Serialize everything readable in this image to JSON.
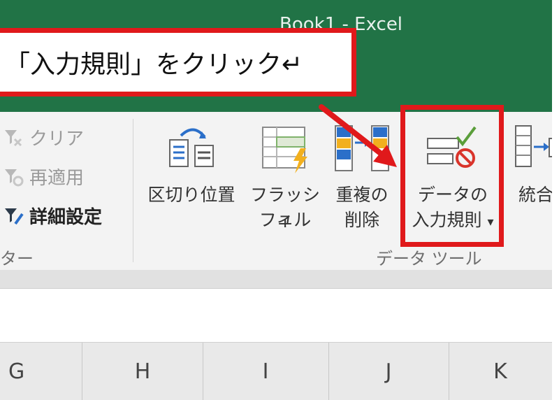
{
  "window": {
    "title": "Book1 - Excel"
  },
  "callout": {
    "text": "「入力規則」をクリック↵"
  },
  "filter_group": {
    "items": [
      {
        "label": "クリア",
        "icon": "clear-filter-icon",
        "enabled": false
      },
      {
        "label": "再適用",
        "icon": "reapply-filter-icon",
        "enabled": false
      },
      {
        "label": "詳細設定",
        "icon": "advanced-filter-icon",
        "enabled": true
      }
    ],
    "group_label": "ター"
  },
  "data_tools": {
    "group_label": "データ ツール",
    "buttons": [
      {
        "line1": "区切り位置",
        "line2": "",
        "icon": "text-to-columns-icon"
      },
      {
        "line1": "フラッシュ",
        "line2": "フィル",
        "icon": "flash-fill-icon"
      },
      {
        "line1": "重複の",
        "line2": "削除",
        "icon": "remove-duplicates-icon"
      },
      {
        "line1": "データの",
        "line2": "入力規則",
        "icon": "data-validation-icon",
        "dropdown": "▾"
      },
      {
        "line1": "統合",
        "line2": "",
        "icon": "consolidate-icon"
      }
    ]
  },
  "columns": [
    "G",
    "H",
    "I",
    "J",
    "K"
  ],
  "colors": {
    "excel_green": "#217346",
    "highlight_red": "#e0191b"
  }
}
